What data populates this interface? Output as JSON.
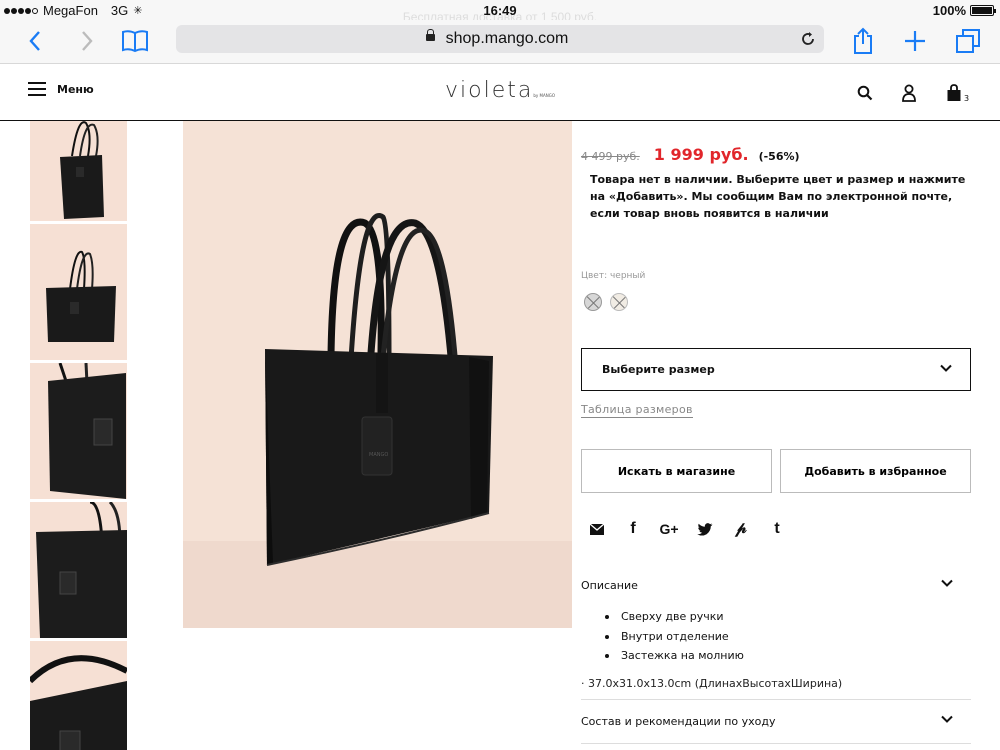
{
  "status_bar": {
    "carrier": "MegaFon",
    "network": "3G",
    "time": "16:49",
    "battery": "100%",
    "promo_text": "Бесплатная доставка от 1 500 руб."
  },
  "browser": {
    "url": "shop.mango.com",
    "icons": [
      "back-icon",
      "forward-icon",
      "bookmarks-icon",
      "lock-icon",
      "reload-icon",
      "share-icon",
      "new-tab-icon",
      "tabs-icon"
    ]
  },
  "header": {
    "menu_label": "Меню",
    "logo_word": "violeta",
    "logo_tag": "by MANGO",
    "bag_count": "3"
  },
  "product": {
    "old_price": "4 499 руб.",
    "new_price": "1 999 руб.",
    "discount": "(-56%)",
    "stock_message": "Товара нет в наличии. Выберите цвет и размер и нажмите на «Добавить». Мы сообщим Вам по электронной почте, если товар вновь появится в наличии",
    "color_label": "Цвет: черный",
    "size_select": "Выберите размер",
    "size_table": "Таблица размеров",
    "store_button": "Искать в магазине",
    "favorite_button": "Добавить в избранное",
    "social": [
      "mail-icon",
      "facebook-icon",
      "google-plus-icon",
      "twitter-icon",
      "pinterest-icon",
      "tumblr-icon"
    ],
    "description_title": "Описание",
    "description_items": [
      "Сверху две ручки",
      "Внутри отделение",
      "Застежка на молнию"
    ],
    "dimensions": "· 37.0x31.0x13.0cm (ДлинахВысотахШирина)",
    "care_title": "Состав и рекомендации по уходу"
  },
  "colors": {
    "price_red": "#e1262b",
    "image_bg": "#f5e2d6"
  }
}
